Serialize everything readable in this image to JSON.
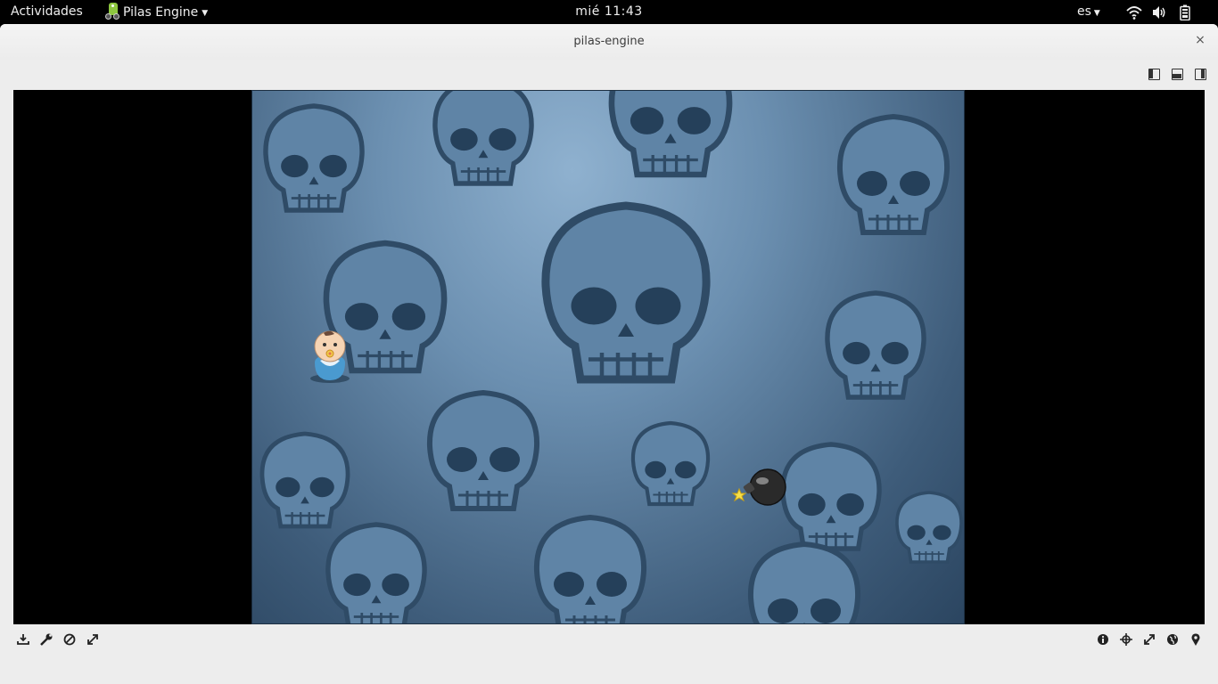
{
  "topbar": {
    "activities": "Actividades",
    "app_name": "Pilas Engine",
    "clock": "mié 11:43",
    "language": "es"
  },
  "window": {
    "title": "pilas-engine",
    "close": "×"
  },
  "colors": {
    "topbar_bg": "#000000",
    "window_bg": "#ededed",
    "stage_dark": "#2b4560",
    "stage_light": "#8fb1cf"
  },
  "icons": {
    "tray": [
      "wifi-icon",
      "volume-icon",
      "battery-icon"
    ],
    "layout": [
      "layout-left-pane-icon",
      "layout-bottom-pane-icon",
      "layout-right-pane-icon"
    ],
    "toolbar_left": [
      "save-icon",
      "wrench-icon",
      "disable-icon",
      "expand-icon"
    ],
    "toolbar_right": [
      "info-icon",
      "crosshair-icon",
      "fullscreen-icon",
      "globe-icon",
      "location-pin-icon"
    ]
  },
  "scene": {
    "actors": [
      "baby-actor",
      "bomb-actor"
    ]
  }
}
